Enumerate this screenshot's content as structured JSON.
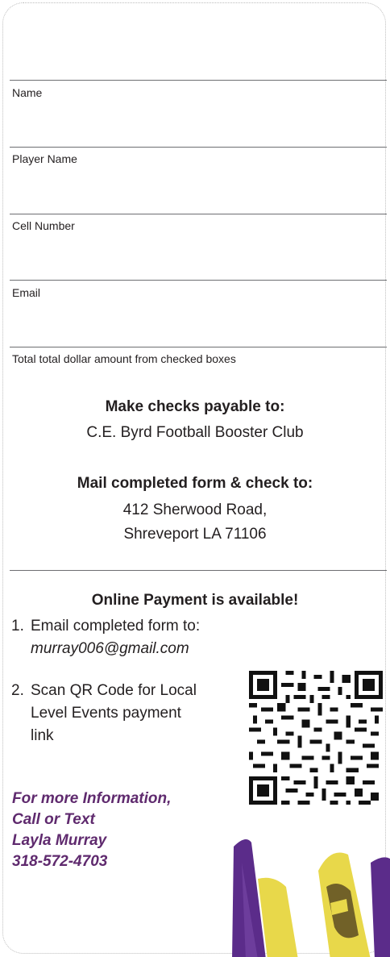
{
  "form": {
    "fields": [
      {
        "label": "Name"
      },
      {
        "label": "Player Name"
      },
      {
        "label": "Cell Number"
      },
      {
        "label": "Email"
      },
      {
        "label": "Total total dollar amount from checked boxes"
      }
    ]
  },
  "payable": {
    "heading": "Make checks payable to:",
    "line1": "C.E. Byrd Football Booster Club"
  },
  "mail": {
    "heading": "Mail completed form & check to:",
    "line1": "412 Sherwood Road,",
    "line2": "Shreveport LA 71106"
  },
  "online": {
    "heading": "Online Payment is available!",
    "step1_num": "1.",
    "step1_text": "Email completed form to:",
    "step1_email": "murray006@gmail.com",
    "step2_num": "2.",
    "step2_line1": "Scan QR Code for Local",
    "step2_line2": "Level Events payment",
    "step2_line3": "link"
  },
  "contact": {
    "line1": "For more Information,",
    "line2": "Call or Text",
    "line3": "Layla Murray",
    "line4": "318-572-4703"
  },
  "colors": {
    "accent": "#5f2a6e",
    "text": "#231f20",
    "rule": "#6d6e71",
    "flag_purple": "#5b2c8a",
    "flag_gold": "#e8d84a"
  },
  "icons": {
    "qr": "qr-code-icon",
    "flags": "team-flags-image"
  }
}
